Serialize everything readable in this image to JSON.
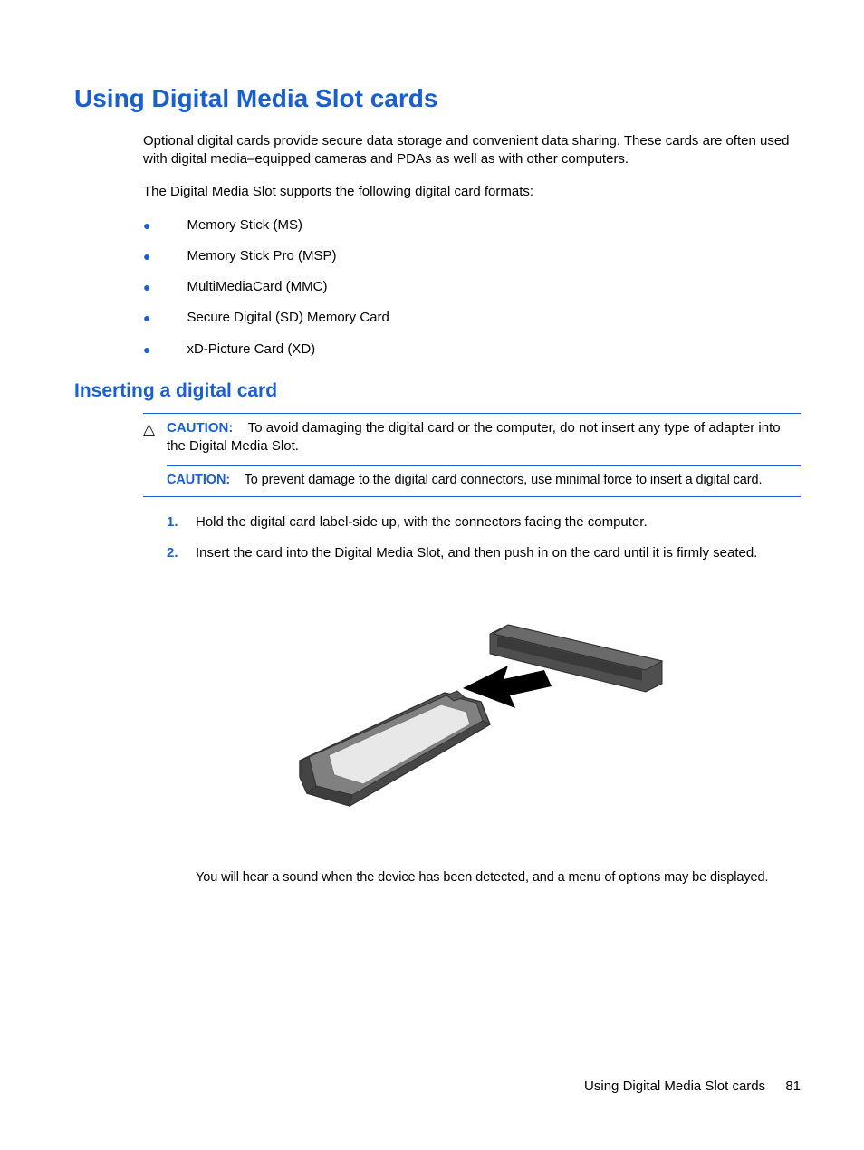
{
  "heading": "Using Digital Media Slot cards",
  "intro": "Optional digital cards provide secure data storage and convenient data sharing. These cards are often used with digital media–equipped cameras and PDAs as well as with other computers.",
  "supports_line": "The Digital Media Slot supports the following digital card formats:",
  "formats": [
    "Memory Stick (MS)",
    "Memory Stick Pro (MSP)",
    "MultiMediaCard (MMC)",
    "Secure Digital (SD) Memory Card",
    "xD-Picture Card (XD)"
  ],
  "subheading": "Inserting a digital card",
  "caution": {
    "label": "CAUTION:",
    "text1": "To avoid damaging the digital card or the computer, do not insert any type of adapter into the Digital Media Slot.",
    "text2": "To prevent damage to the digital card connectors, use minimal force to insert a digital card."
  },
  "steps": [
    "Hold the digital card label-side up, with the connectors facing the computer.",
    "Insert the card into the Digital Media Slot, and then push in on the card until it is firmly seated."
  ],
  "after_image": "You will hear a sound when the device has been detected, and a menu of options may be displayed.",
  "footer": {
    "title": "Using Digital Media Slot cards",
    "page": "81"
  }
}
